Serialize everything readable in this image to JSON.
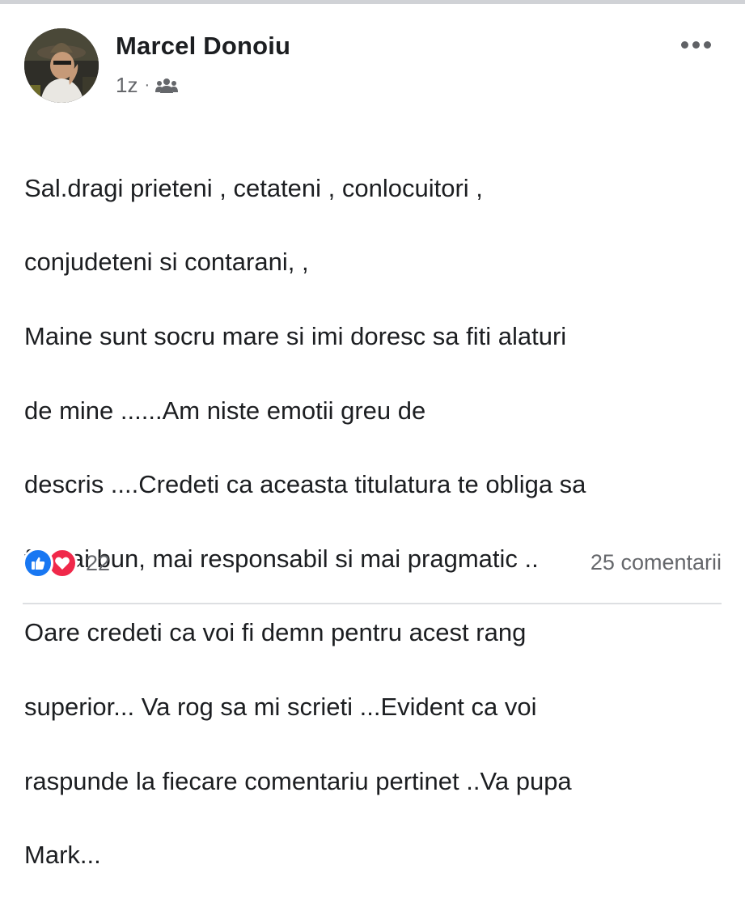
{
  "post": {
    "author_name": "Marcel Donoiu",
    "timestamp": "1z",
    "separator": "·",
    "audience_icon": "friends-icon",
    "more_icon": "more-options-icon",
    "lines": [
      "Sal.dragi prieteni  , cetateni , conlocuitori ,",
      "conjudeteni  si contarani, ,",
      "Maine sunt socru mare si imi doresc sa fiti alaturi",
      "de mine ......Am niste emotii greu de",
      "descris ....Credeti  ca aceasta titulatura te obliga sa",
      "fii mai bun, mai responsabil si mai pragmatic ..",
      "Oare credeti ca voi fi demn pentru acest rang",
      "superior... Va rog sa mi scrieti ...Evident ca voi",
      "raspunde la fiecare comentariu pertinet ..Va pupa",
      "Mark..."
    ]
  },
  "footer": {
    "reactions": [
      "like",
      "love"
    ],
    "reaction_count": "22",
    "comments_label": "25 comentarii"
  },
  "colors": {
    "like": "#1877f2",
    "love": "#f0284a",
    "secondary_text": "#65676b"
  }
}
